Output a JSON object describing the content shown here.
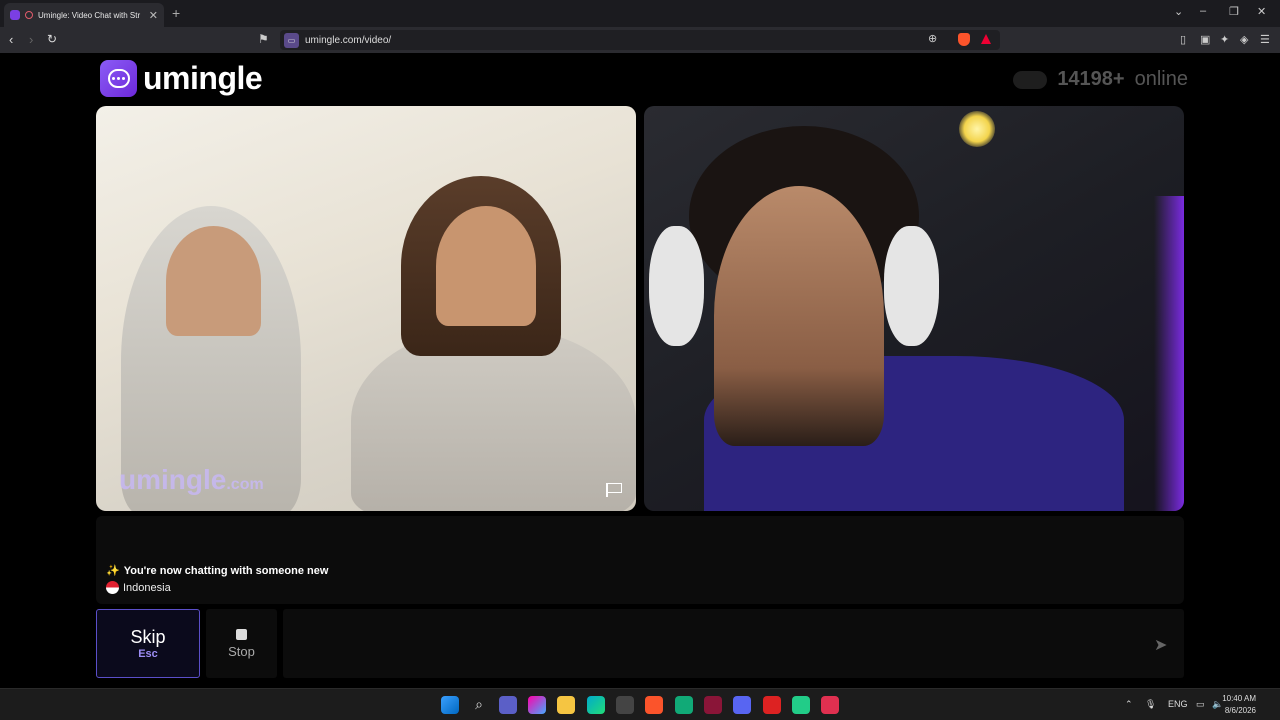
{
  "browser": {
    "tab_title": "Umingle: Video Chat with Str",
    "url": "umingle.com/video/"
  },
  "site": {
    "logo_text": "umingle",
    "online_count": "14198+",
    "online_label": "online",
    "watermark_main": "umingle",
    "watermark_suffix": ".com"
  },
  "chat": {
    "status_message": "You're now chatting with someone new",
    "country": "Indonesia",
    "message_placeholder": ""
  },
  "controls": {
    "skip_label": "Skip",
    "skip_key": "Esc",
    "stop_label": "Stop"
  },
  "taskbar": {
    "language": "ENG",
    "time": "10:40 AM",
    "date": "8/6/2026"
  },
  "colors": {
    "brand": "#7c3aed",
    "skip_border": "#5b4fc9"
  }
}
